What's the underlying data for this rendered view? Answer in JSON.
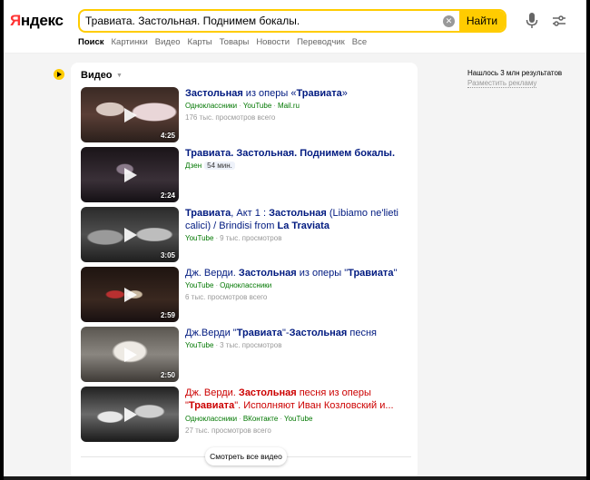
{
  "header": {
    "logo_first": "Я",
    "logo_rest": "ндекс",
    "search_value": "Травиата. Застольная. Поднимем бокалы.",
    "clear_label": "✕",
    "find_label": "Найти"
  },
  "nav": {
    "tabs": [
      "Поиск",
      "Картинки",
      "Видео",
      "Карты",
      "Товары",
      "Новости",
      "Переводчик",
      "Все"
    ]
  },
  "section": {
    "title": "Видео",
    "caret": "▼"
  },
  "right": {
    "found": "Нашлось 3 млн результатов",
    "ads": "Разместить рекламу"
  },
  "videos": [
    {
      "title_parts": [
        [
          "b",
          "Застольная"
        ],
        [
          "t",
          " из оперы «"
        ],
        [
          "b",
          "Травиата"
        ],
        [
          "t",
          "»"
        ]
      ],
      "sources": [
        "Одноклассники",
        "YouTube",
        "Mail.ru"
      ],
      "views": "176 тыс. просмотров всего",
      "duration": "4:25",
      "visited": false
    },
    {
      "title_parts": [
        [
          "b",
          "Травиата. Застольная. Поднимем бокалы."
        ]
      ],
      "sources": [
        "Дзен"
      ],
      "badge": "54 мин.",
      "views": "",
      "duration": "2:24",
      "visited": false
    },
    {
      "title_parts": [
        [
          "b",
          "Травиата"
        ],
        [
          "t",
          ", Акт 1 : "
        ],
        [
          "b",
          "Застольная"
        ],
        [
          "t",
          " (Libiamo ne'lieti calici) / Brindisi from "
        ],
        [
          "b",
          "La Traviata"
        ]
      ],
      "sources": [
        "YouTube"
      ],
      "views_inline": "9 тыс. просмотров",
      "views": "",
      "duration": "3:05",
      "visited": false
    },
    {
      "title_parts": [
        [
          "t",
          "Дж. Верди. "
        ],
        [
          "b",
          "Застольная"
        ],
        [
          "t",
          " из оперы \""
        ],
        [
          "b",
          "Травиата"
        ],
        [
          "t",
          "\""
        ]
      ],
      "sources": [
        "YouTube",
        "Одноклассники"
      ],
      "views": "6 тыс. просмотров всего",
      "duration": "2:59",
      "visited": false
    },
    {
      "title_parts": [
        [
          "t",
          "Дж.Верди \""
        ],
        [
          "b",
          "Травиата"
        ],
        [
          "t",
          "\"-"
        ],
        [
          "b",
          "Застольная"
        ],
        [
          "t",
          " песня"
        ]
      ],
      "sources": [
        "YouTube"
      ],
      "views_inline": "3 тыс. просмотров",
      "views": "",
      "duration": "2:50",
      "visited": false
    },
    {
      "title_parts": [
        [
          "t",
          "Дж. Верди. "
        ],
        [
          "b",
          "Застольная"
        ],
        [
          "t",
          " песня из оперы \""
        ],
        [
          "b",
          "Травиата"
        ],
        [
          "t",
          "\". Исполняют Иван Козловский и..."
        ]
      ],
      "sources": [
        "Одноклассники",
        "ВКонтакте",
        "YouTube"
      ],
      "views": "27 тыс. просмотров всего",
      "duration": "",
      "visited": true
    }
  ],
  "see_all": "Смотреть все видео",
  "colors": {
    "accent": "#ffcc00",
    "link": "#001a80",
    "source": "#007700",
    "visited": "#cc0000"
  }
}
